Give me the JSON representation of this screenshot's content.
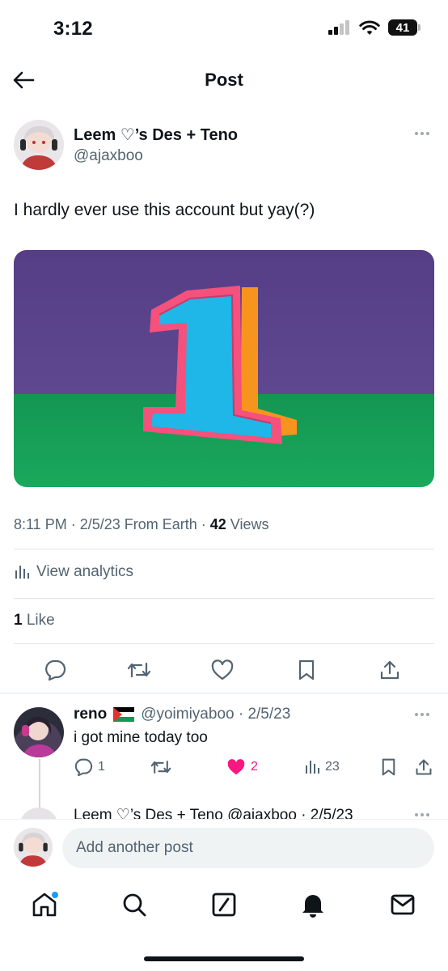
{
  "status_bar": {
    "time": "3:12",
    "battery": "41"
  },
  "header": {
    "title": "Post"
  },
  "post": {
    "author_name": "Leem ♡’s Des + Teno",
    "author_handle": "@ajaxboo",
    "text": "I hardly ever use this account but yay(?)",
    "timestamp": "8:11 PM · 2/5/23 From Earth · ",
    "views_count": "42",
    "views_label": " Views",
    "analytics_label": "View analytics",
    "likes_count": "1",
    "likes_label": " Like"
  },
  "reply": {
    "author_name": "reno",
    "flag": "🇵🇸",
    "meta": "@yoimiyaboo · 2/5/23",
    "text": "i got mine today too",
    "reply_count": "1",
    "like_count": "2",
    "view_count": "23"
  },
  "next_reply": {
    "text": "Leem ♡’s Des + Teno @ajaxboo · 2/5/23"
  },
  "compose": {
    "placeholder": "Add another post"
  },
  "colors": {
    "accent": "#1d9bf0",
    "like": "#f91880",
    "text": "#0f1419",
    "secondary": "#536471"
  },
  "icons": [
    "back-arrow-icon",
    "more-icon",
    "analytics-icon",
    "reply-icon",
    "repost-icon",
    "like-icon",
    "bookmark-icon",
    "share-icon",
    "home-icon",
    "search-icon",
    "compose-icon",
    "notifications-icon",
    "messages-icon"
  ]
}
